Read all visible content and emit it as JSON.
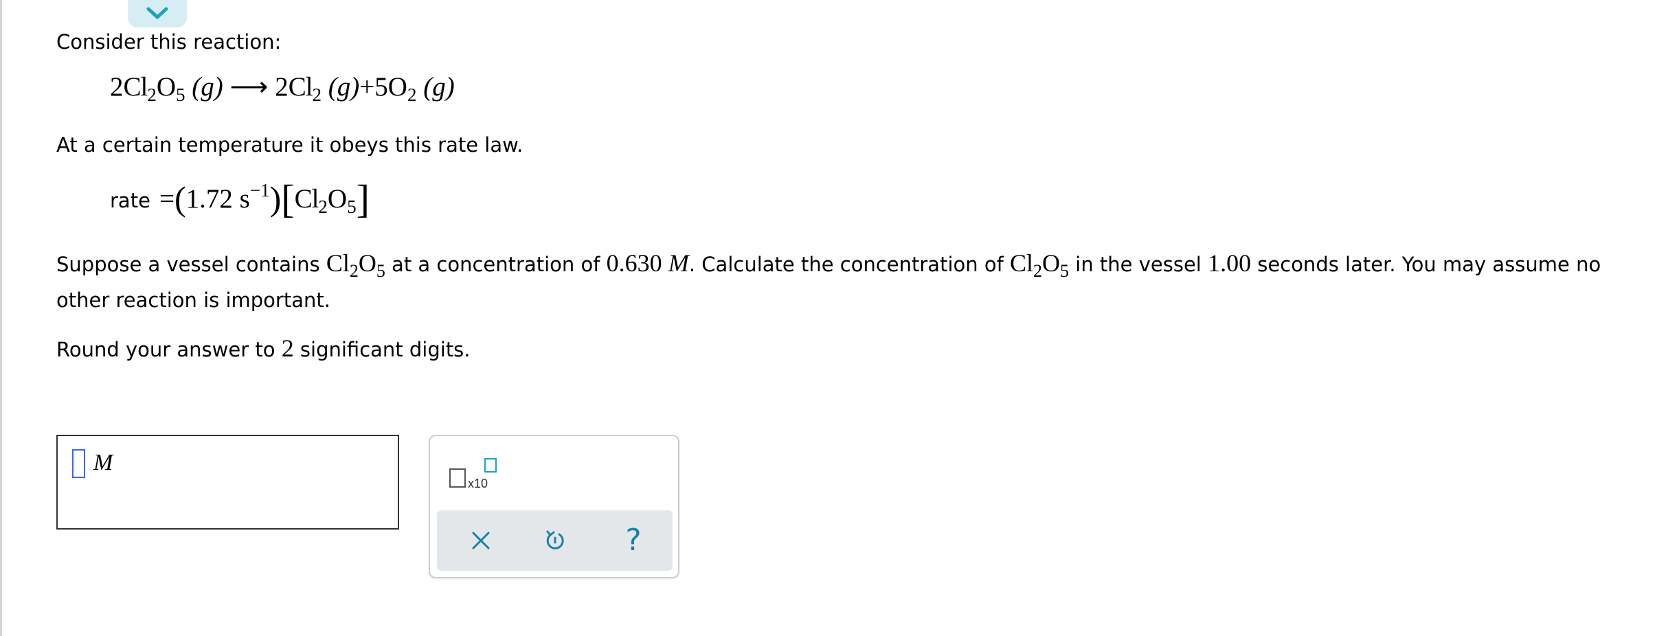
{
  "intro": "Consider this reaction:",
  "reaction": {
    "coef1": "2",
    "cl": "Cl",
    "sub2": "2",
    "o": "O",
    "sub5": "5",
    "gas": "(g)",
    "arrow": "⟶",
    "coef2": "2",
    "plus": "+",
    "coef3": "5"
  },
  "rate_intro": "At a certain temperature it obeys this rate law.",
  "rate_law": {
    "word": "rate",
    "equals": "=",
    "open_paren": "(",
    "k_value": "1.72",
    "unit": "s",
    "exponent": "−1",
    "close_paren": ")",
    "open_bracket": "[",
    "close_bracket": "]"
  },
  "question": {
    "part1": "Suppose a vessel contains ",
    "part2": " at a concentration of ",
    "conc_value": "0.630",
    "conc_unit": "M",
    "part3": ". Calculate the concentration of ",
    "part4": " in the vessel ",
    "time_value": "1.00",
    "part5": " seconds later. You may assume no",
    "line2": "other reaction is important."
  },
  "rounding": {
    "part1": "Round your answer to ",
    "digits": "2",
    "part2": " significant digits."
  },
  "answer": {
    "unit": "M"
  },
  "tools": {
    "sci_label": "x10"
  },
  "colors": {
    "accent": "#1aa3c0",
    "caret": "#3b63ff",
    "tab_bg": "#d6eef3"
  }
}
